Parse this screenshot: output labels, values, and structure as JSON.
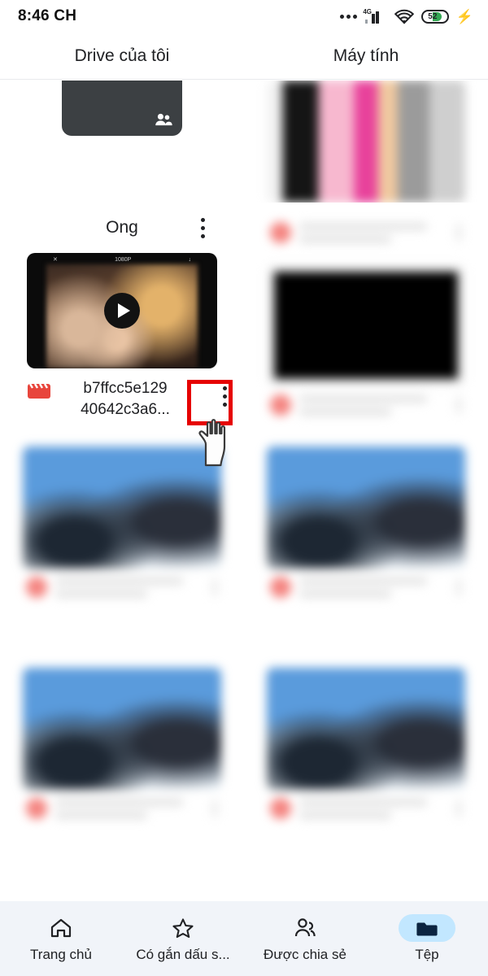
{
  "status_bar": {
    "time": "8:46 CH",
    "network_type": "4G",
    "battery_percent": "52",
    "icons": [
      "more-dots-icon",
      "signal-4g-icon",
      "wifi-icon",
      "battery-icon",
      "charging-bolt-icon"
    ]
  },
  "tabs": [
    {
      "label": "Drive của tôi",
      "active": true
    },
    {
      "label": "Máy tính",
      "active": false
    }
  ],
  "items": [
    {
      "type": "folder",
      "name": "Ong",
      "shared": true,
      "menu_icon": "kebab-menu-icon"
    },
    {
      "type": "video",
      "name": "b7ffcc5e12940642c3a6...",
      "name_line1": "b7ffcc5e129",
      "name_line2": "40642c3a6...",
      "file_icon": "clapperboard-icon",
      "overlay": "play-button-icon",
      "thumb_quality_label": "1080P",
      "menu_icon": "kebab-menu-icon"
    }
  ],
  "annotation": {
    "highlight_color": "#e60000",
    "target": "kebab-menu-icon",
    "cursor": "hand-pointer-cursor"
  },
  "bottom_nav": [
    {
      "label": "Trang chủ",
      "icon": "home-icon",
      "active": false
    },
    {
      "label": "Có gắn dấu s...",
      "icon": "star-icon",
      "active": false
    },
    {
      "label": "Được chia sẻ",
      "icon": "people-icon",
      "active": false
    },
    {
      "label": "Tệp",
      "icon": "folder-icon",
      "active": true
    }
  ],
  "colors": {
    "accent_pill": "#c2e7ff",
    "folder_card": "#3c4043",
    "folder_tab": "#2c5cc5",
    "video_icon": "#e8453c",
    "nav_background": "#f1f4f9"
  }
}
